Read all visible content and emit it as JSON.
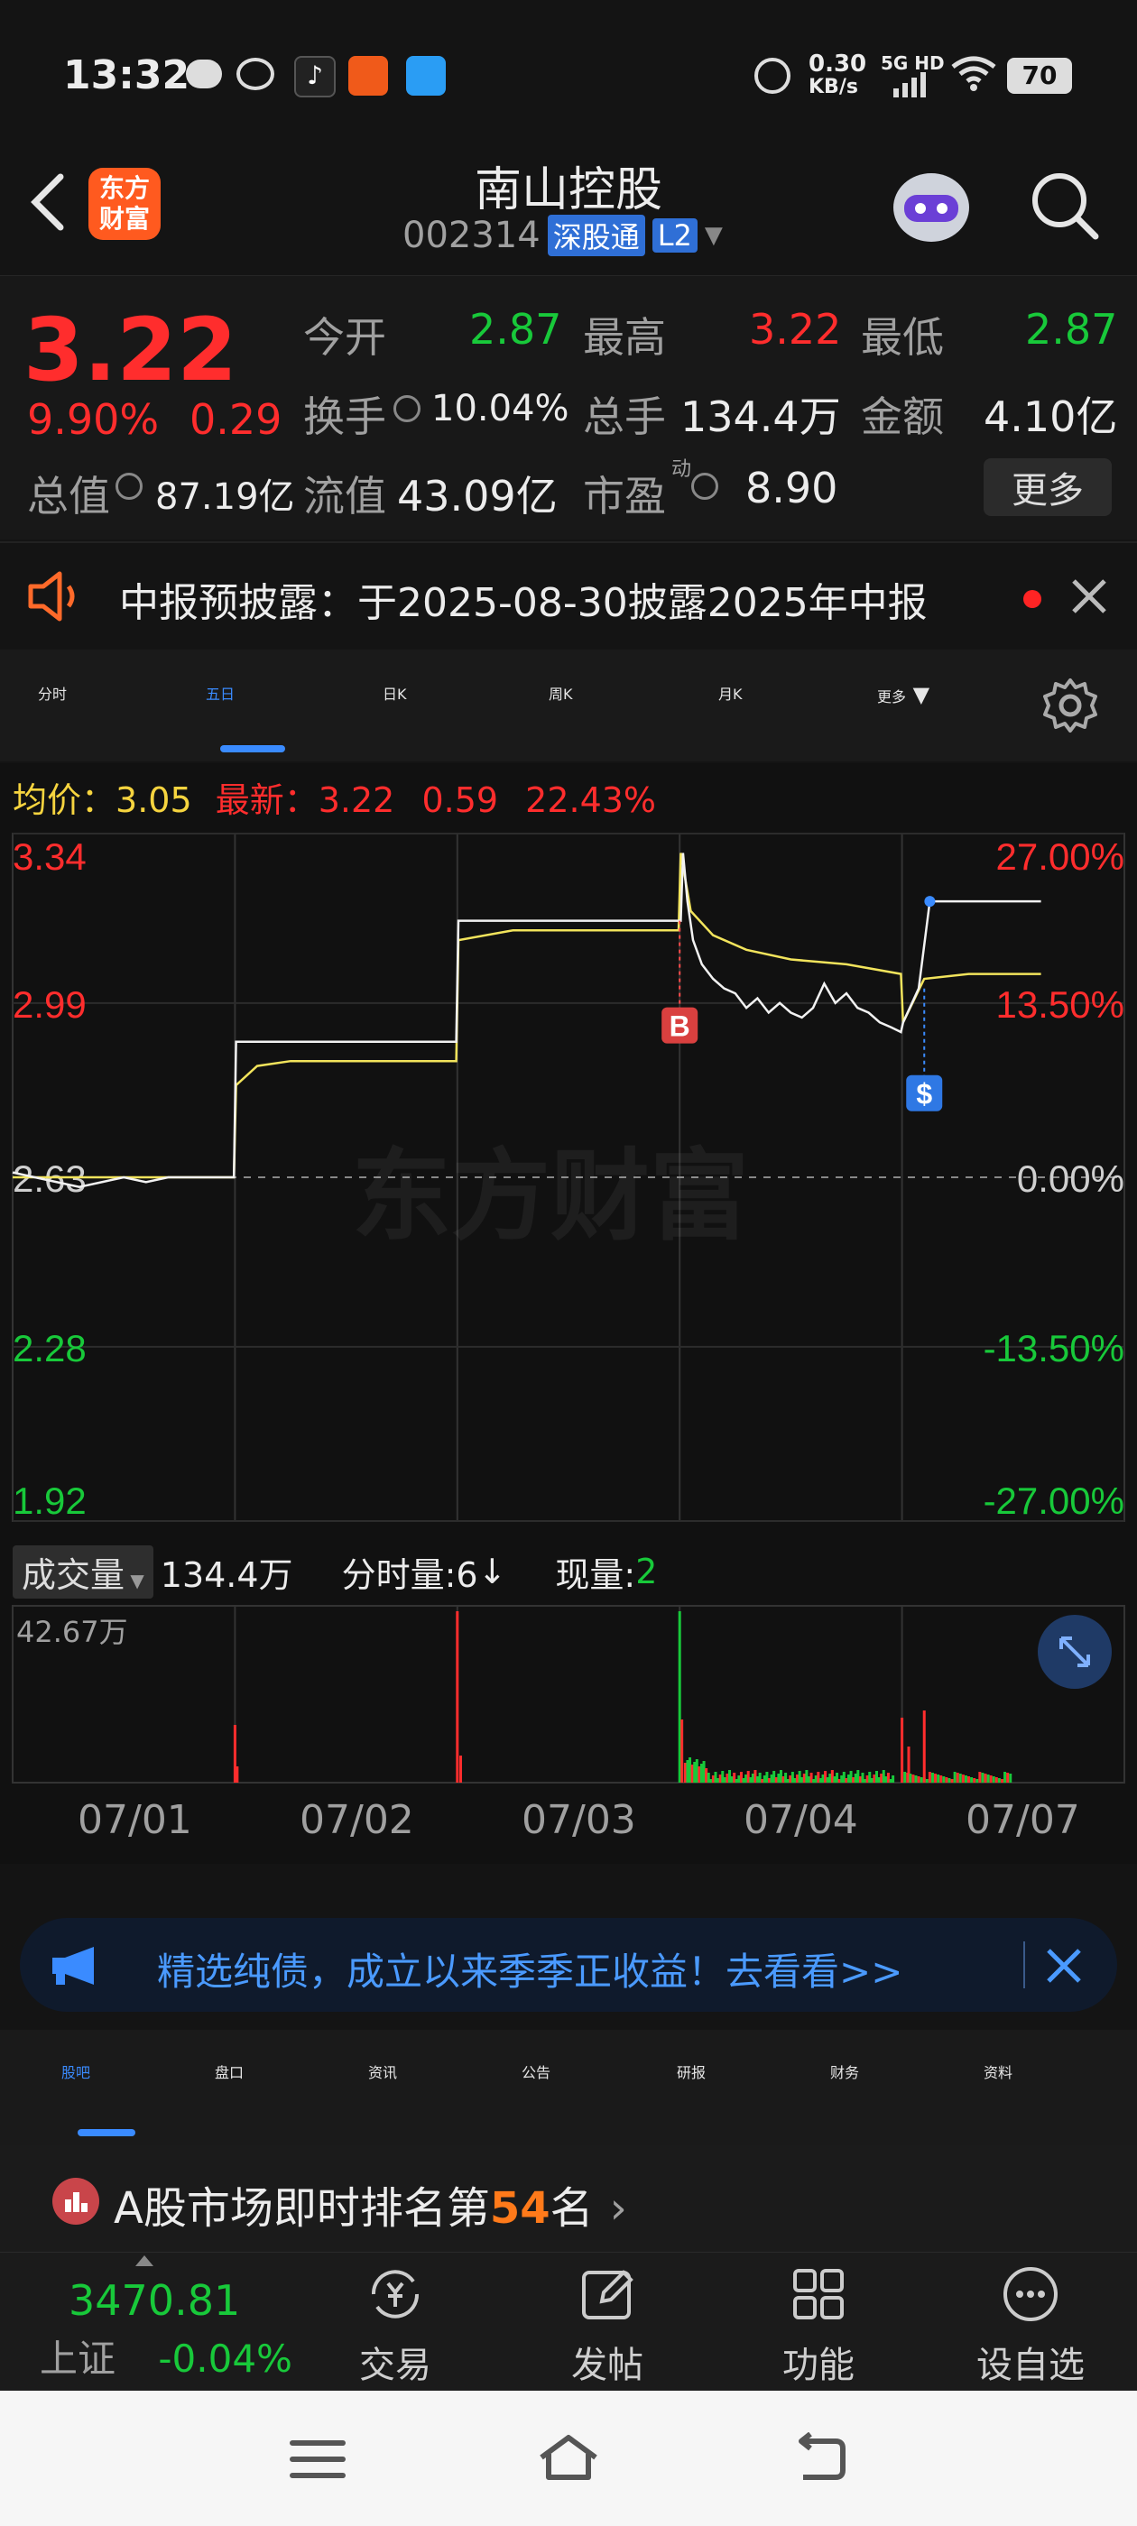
{
  "status_bar": {
    "time": "13:32",
    "net_speed_top": "0.30",
    "net_speed_unit": "KB/s",
    "network": "5G HD",
    "battery": "70"
  },
  "header": {
    "title": "南山控股",
    "code": "002314",
    "exchange_tag": "深股通",
    "level_tag": "L2",
    "logo_text_1": "东方",
    "logo_text_2": "财富"
  },
  "quote": {
    "price": "3.22",
    "change_pct": "9.90%",
    "change": "0.29",
    "open_label": "今开",
    "open": "2.87",
    "high_label": "最高",
    "high": "3.22",
    "low_label": "最低",
    "low": "2.87",
    "turnover_label": "换手",
    "turnover": "10.04%",
    "volume_label": "总手",
    "volume": "134.4万",
    "amount_label": "金额",
    "amount": "4.10亿",
    "mktcap_label": "总值",
    "mktcap": "87.19亿",
    "float_label": "流值",
    "float_value": "43.09亿",
    "pe_label": "市盈",
    "pe_sup": "动",
    "pe": "8.90",
    "more_button": "更多"
  },
  "notice": {
    "text": "中报预披露：于2025-08-30披露2025年中报"
  },
  "chart_tabs": [
    "分时",
    "五日",
    "日K",
    "周K",
    "月K",
    "更多"
  ],
  "chart_tab_active": "五日",
  "chart_legend": {
    "avg_label": "均价：",
    "avg": "3.05",
    "latest_label": "最新：",
    "latest": "3.22",
    "latest_change": "0.59",
    "latest_pct": "22.43%"
  },
  "volume_legend": {
    "selector": "成交量",
    "total": "134.4万",
    "tick_label": "分时量:6",
    "arrow": "↓",
    "now_label": "现量:",
    "now_value": "2",
    "max": "42.67万"
  },
  "chart_data": {
    "type": "line",
    "x_labels": [
      "07/01",
      "07/02",
      "07/03",
      "07/04",
      "07/07"
    ],
    "y_left_ticks": [
      "3.34",
      "2.99",
      "2.63",
      "2.28",
      "1.92"
    ],
    "y_right_ticks": [
      "27.00%",
      "13.50%",
      "0.00%",
      "-13.50%",
      "-27.00%"
    ],
    "ylim": [
      1.92,
      3.34
    ],
    "baseline": 2.63,
    "price_series": [
      [
        0.0,
        2.64
      ],
      [
        0.02,
        2.63
      ],
      [
        0.04,
        2.62
      ],
      [
        0.06,
        2.61
      ],
      [
        0.08,
        2.62
      ],
      [
        0.1,
        2.63
      ],
      [
        0.12,
        2.62
      ],
      [
        0.14,
        2.63
      ],
      [
        0.16,
        2.63
      ],
      [
        0.18,
        2.63
      ],
      [
        0.199,
        2.63
      ],
      [
        0.201,
        2.91
      ],
      [
        0.25,
        2.91
      ],
      [
        0.3,
        2.91
      ],
      [
        0.35,
        2.91
      ],
      [
        0.399,
        2.91
      ],
      [
        0.401,
        3.16
      ],
      [
        0.45,
        3.16
      ],
      [
        0.5,
        3.16
      ],
      [
        0.55,
        3.16
      ],
      [
        0.599,
        3.16
      ],
      [
        0.601,
        3.16
      ],
      [
        0.603,
        3.3
      ],
      [
        0.607,
        3.2
      ],
      [
        0.612,
        3.12
      ],
      [
        0.62,
        3.07
      ],
      [
        0.63,
        3.04
      ],
      [
        0.64,
        3.02
      ],
      [
        0.65,
        3.01
      ],
      [
        0.66,
        2.98
      ],
      [
        0.67,
        3.0
      ],
      [
        0.68,
        2.97
      ],
      [
        0.69,
        2.99
      ],
      [
        0.7,
        2.97
      ],
      [
        0.71,
        2.96
      ],
      [
        0.72,
        2.98
      ],
      [
        0.73,
        3.03
      ],
      [
        0.74,
        2.99
      ],
      [
        0.75,
        3.01
      ],
      [
        0.76,
        2.98
      ],
      [
        0.77,
        2.97
      ],
      [
        0.78,
        2.95
      ],
      [
        0.79,
        2.94
      ],
      [
        0.799,
        2.93
      ],
      [
        0.801,
        2.95
      ],
      [
        0.815,
        3.02
      ],
      [
        0.825,
        3.2
      ],
      [
        0.9,
        3.2
      ],
      [
        0.925,
        3.2
      ]
    ],
    "avg_series": [
      [
        0.0,
        2.63
      ],
      [
        0.1,
        2.63
      ],
      [
        0.199,
        2.63
      ],
      [
        0.201,
        2.82
      ],
      [
        0.22,
        2.86
      ],
      [
        0.25,
        2.87
      ],
      [
        0.3,
        2.87
      ],
      [
        0.399,
        2.87
      ],
      [
        0.401,
        3.12
      ],
      [
        0.45,
        3.14
      ],
      [
        0.599,
        3.14
      ],
      [
        0.601,
        3.3
      ],
      [
        0.61,
        3.18
      ],
      [
        0.63,
        3.13
      ],
      [
        0.66,
        3.1
      ],
      [
        0.7,
        3.08
      ],
      [
        0.75,
        3.07
      ],
      [
        0.799,
        3.05
      ],
      [
        0.801,
        2.95
      ],
      [
        0.82,
        3.04
      ],
      [
        0.86,
        3.05
      ],
      [
        0.925,
        3.05
      ]
    ],
    "markers": [
      {
        "label": "B",
        "x": 0.6,
        "y": 3.16
      },
      {
        "label": "S",
        "x": 0.82,
        "y": 3.02
      }
    ],
    "volume_max": 42.67
  },
  "ad": {
    "text": "精选纯债，成立以来季季正收益！去看看>>"
  },
  "sub_tabs": [
    "股吧",
    "盘口",
    "资讯",
    "公告",
    "研报",
    "财务",
    "资料"
  ],
  "sub_tab_active": "股吧",
  "rank": {
    "prefix": "A股市场即时排名第",
    "number": "54",
    "suffix": "名"
  },
  "bottom_nav": {
    "index_value": "3470.81",
    "index_name": "上证",
    "index_change": "-0.04%",
    "items": [
      "交易",
      "发帖",
      "功能",
      "设自选"
    ]
  },
  "colors": {
    "up": "#ff2d2d",
    "down": "#18c93a",
    "accent": "#3a8bff",
    "bg": "#141414"
  }
}
